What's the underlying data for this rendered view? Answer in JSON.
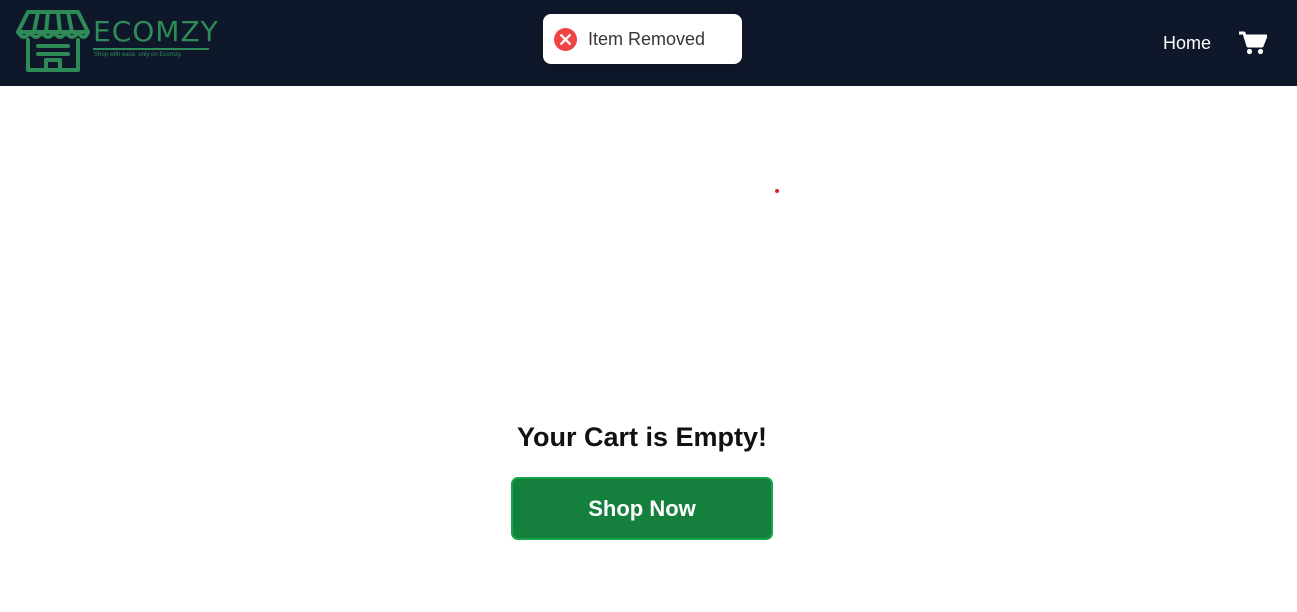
{
  "brand": {
    "name": "ECOMZY",
    "tagline": "Shop with ease, only on Ecomzy.",
    "logo_icon": "storefront-icon",
    "color": "#2e8b57"
  },
  "nav": {
    "home_label": "Home",
    "cart_icon": "shopping-cart-icon",
    "background": "#0f172a"
  },
  "toast": {
    "message": "Item Removed",
    "icon": "error-x-icon",
    "icon_color": "#ef4444"
  },
  "cart": {
    "empty_message": "Your Cart is Empty!",
    "shop_button_label": "Shop Now",
    "button_color": "#15803d"
  }
}
